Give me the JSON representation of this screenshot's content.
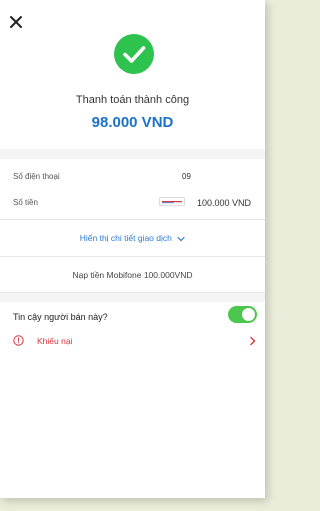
{
  "header": {
    "close_icon": "close-icon",
    "status_icon": "check-circle-icon",
    "title": "Thanh toán thành công",
    "amount": "98.000 VND",
    "accent_color": "#2ec24e",
    "amount_color": "#1a73c8"
  },
  "details": {
    "phone": {
      "label": "Số điện thoại",
      "value": "09"
    },
    "amount": {
      "label": "Số tiền",
      "logo": "mobifone",
      "value": "100.000 VND"
    }
  },
  "details_link": {
    "label": "Hiển thị chi tiết giao dịch",
    "icon": "chevron-down-icon"
  },
  "description": "Nạp tiền Mobifone 100.000VND",
  "trust": {
    "label": "Tin cậy người bán này?",
    "enabled": true,
    "toggle_color": "#4cc64d"
  },
  "complaint": {
    "label": "Khiếu nại",
    "icon": "alert-circle-icon",
    "arrow_icon": "chevron-right-icon",
    "color": "#d9343c"
  }
}
